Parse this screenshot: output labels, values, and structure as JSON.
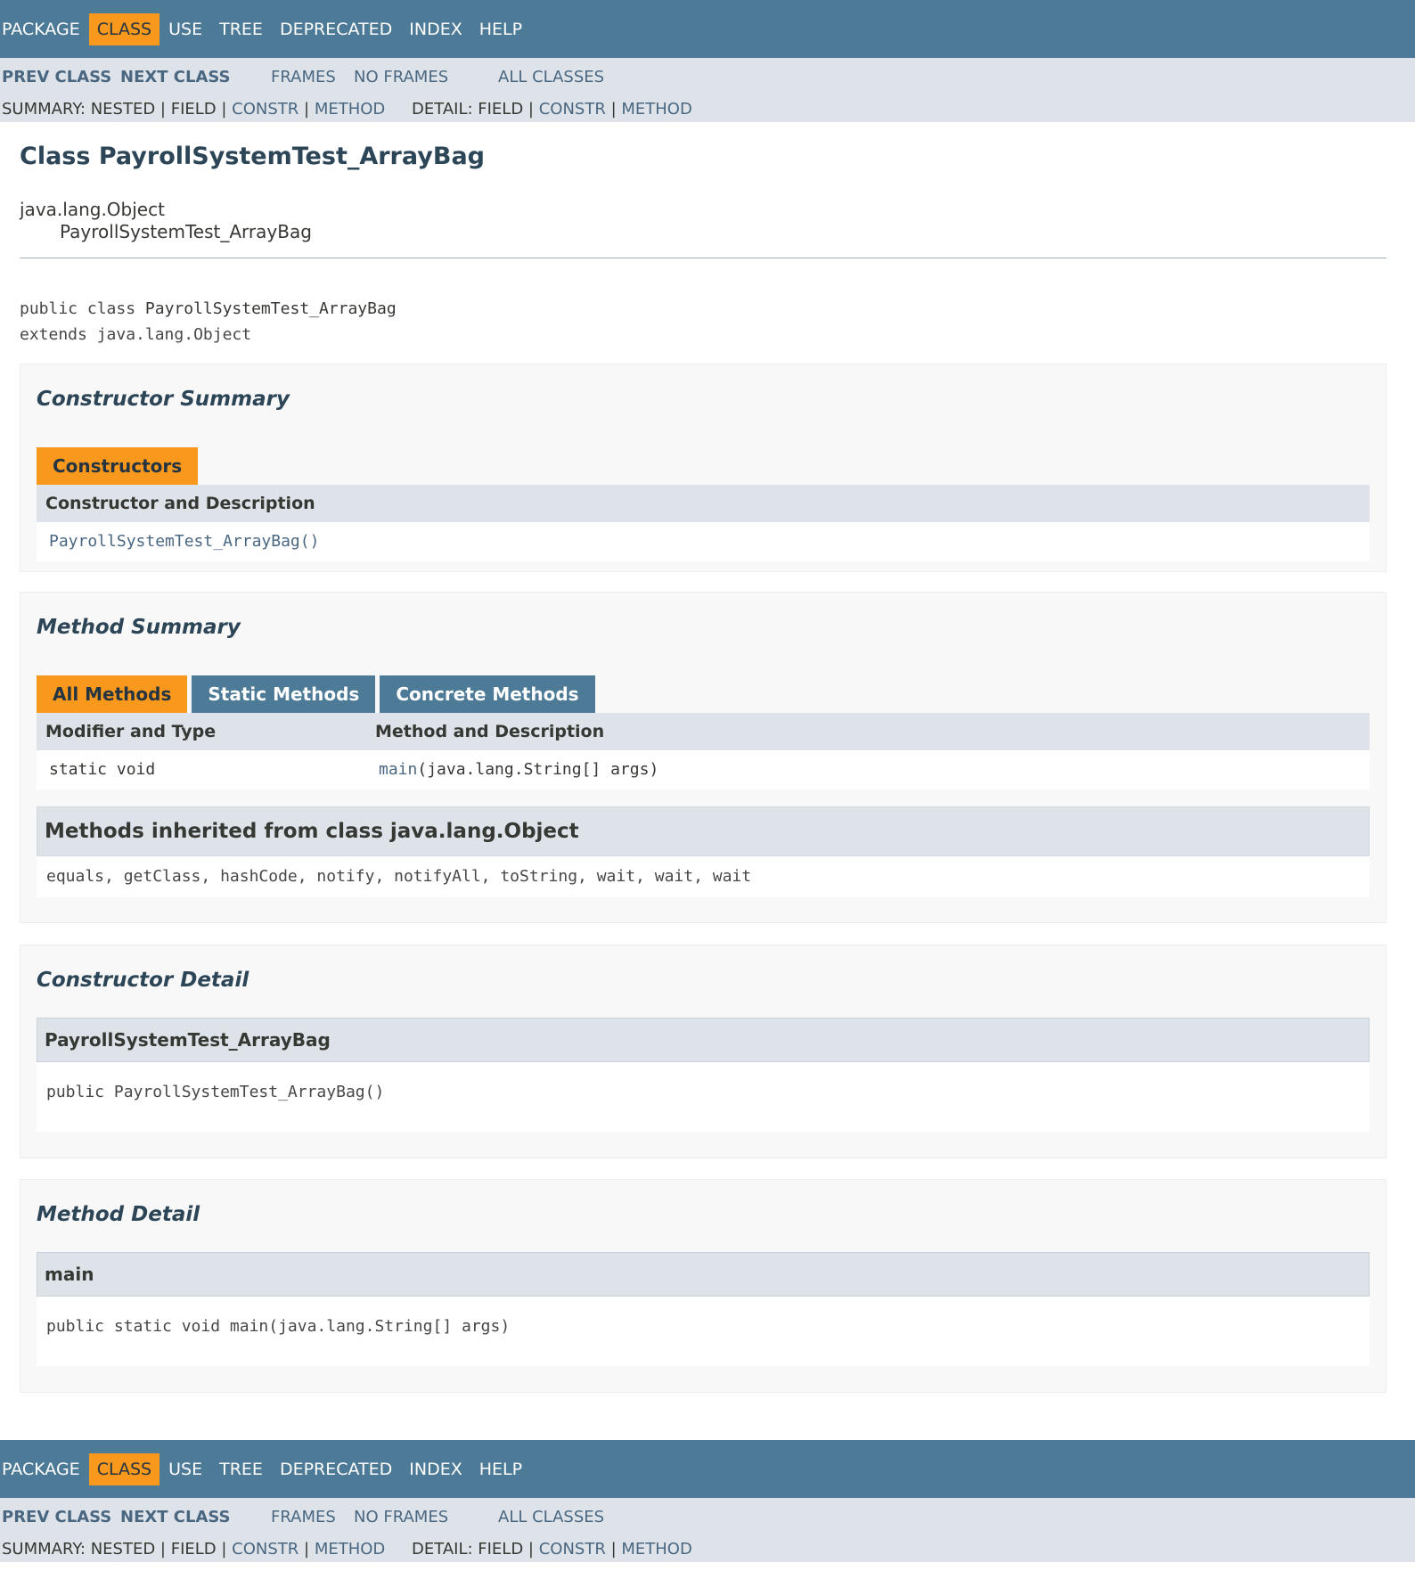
{
  "nav": {
    "items": [
      "PACKAGE",
      "CLASS",
      "USE",
      "TREE",
      "DEPRECATED",
      "INDEX",
      "HELP"
    ],
    "active": "CLASS"
  },
  "subnav": {
    "prev_class": "PREV CLASS",
    "next_class": "NEXT CLASS",
    "frames": "FRAMES",
    "no_frames": "NO FRAMES",
    "all_classes": "ALL CLASSES",
    "summary_label": "SUMMARY: NESTED | FIELD | ",
    "summary_constr": "CONSTR",
    "summary_method": "METHOD",
    "detail_label": "DETAIL: FIELD | ",
    "detail_constr": "CONSTR",
    "detail_method": "METHOD",
    "sep": " | "
  },
  "header": {
    "title": "Class PayrollSystemTest_ArrayBag",
    "parent": "java.lang.Object",
    "child": "PayrollSystemTest_ArrayBag",
    "decl_prefix": "public class ",
    "decl_name": "PayrollSystemTest_ArrayBag",
    "decl_extends": "extends java.lang.Object"
  },
  "constructor_summary": {
    "title": "Constructor Summary",
    "tab": "Constructors",
    "column": "Constructor and Description",
    "row": "PayrollSystemTest_ArrayBag()"
  },
  "method_summary": {
    "title": "Method Summary",
    "tabs": [
      "All Methods",
      "Static Methods",
      "Concrete Methods"
    ],
    "columns": [
      "Modifier and Type",
      "Method and Description"
    ],
    "rows": [
      {
        "modifier": "static void",
        "method_name": "main",
        "method_params": "(java.lang.String[] args)"
      }
    ],
    "inherited_title": "Methods inherited from class java.lang.Object",
    "inherited_list": "equals, getClass, hashCode, notify, notifyAll, toString, wait, wait, wait"
  },
  "constructor_detail": {
    "title": "Constructor Detail",
    "name": "PayrollSystemTest_ArrayBag",
    "signature": "public PayrollSystemTest_ArrayBag()"
  },
  "method_detail": {
    "title": "Method Detail",
    "name": "main",
    "signature": "public static void main(java.lang.String[] args)"
  },
  "colors": {
    "nav_bg": "#4d7a97",
    "active_tab": "#f8981d",
    "subnav_bg": "#dee3e9",
    "link": "#4a6782",
    "title": "#2c4557"
  }
}
